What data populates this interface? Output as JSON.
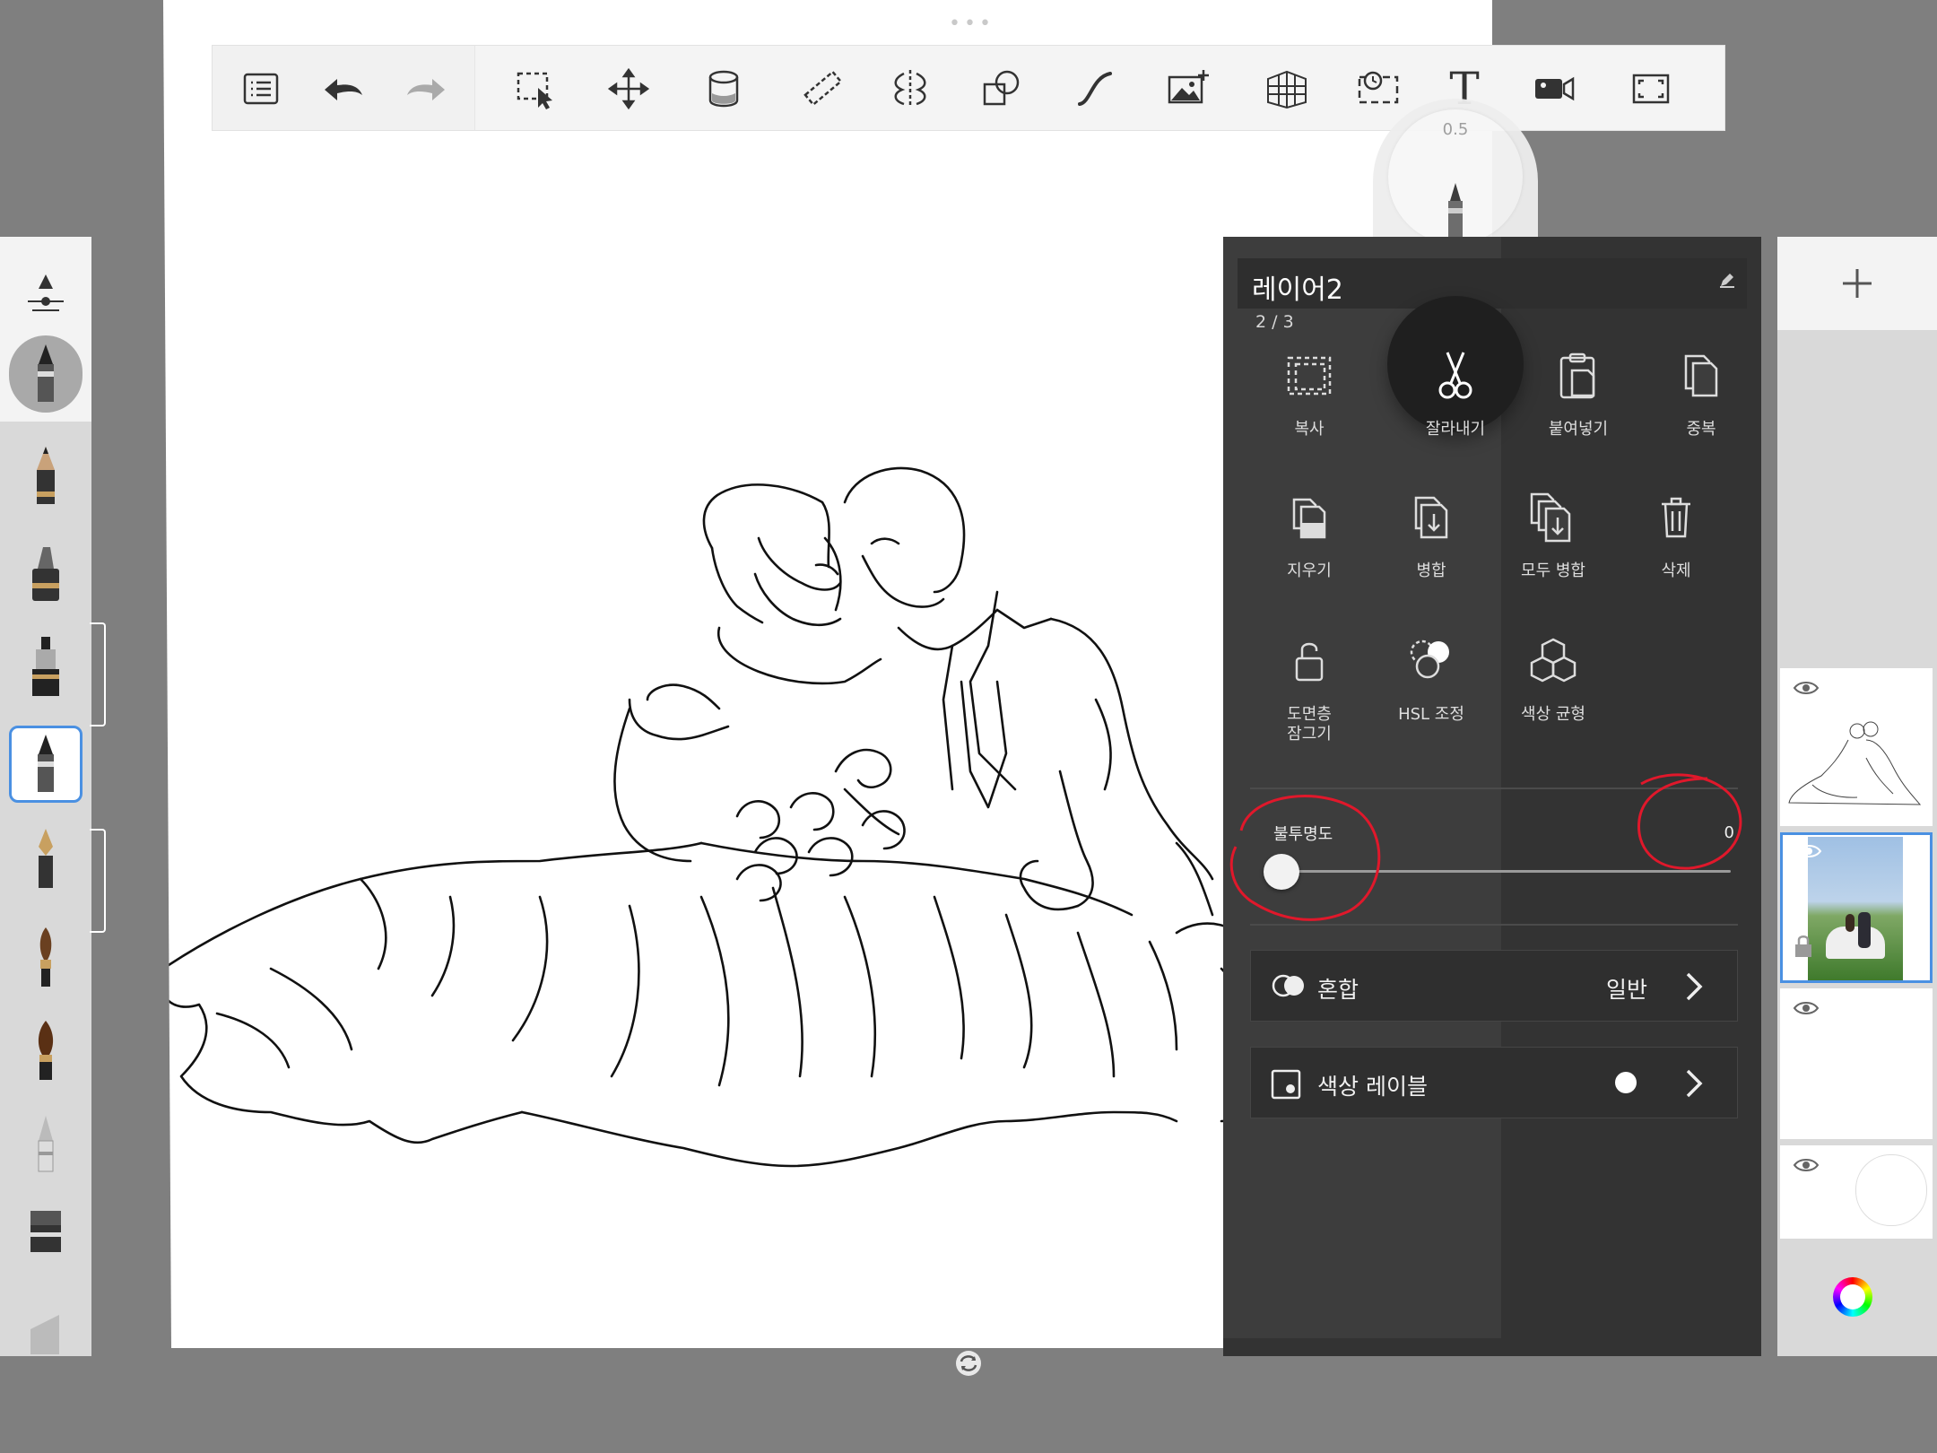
{
  "toolbar": {
    "icons": [
      "list-icon",
      "undo-icon",
      "redo-icon",
      "selection-icon",
      "transform-icon",
      "fill-icon",
      "ruler-icon",
      "symmetry-icon",
      "shape-icon",
      "curve-icon",
      "add-image-icon",
      "perspective-icon",
      "time-lapse-icon",
      "text-icon",
      "video-icon",
      "fullscreen-icon"
    ],
    "text_glyph": "T"
  },
  "brush_puck": {
    "size": "0.5"
  },
  "brushes": [
    "brush-settings-icon",
    "current-brush-icon",
    "pencil-icon",
    "marker-icon",
    "technical-pen-icon",
    "ballpoint-pen-icon",
    "fountain-pen-icon",
    "paintbrush-icon",
    "round-brush-icon",
    "airbrush-icon",
    "flat-marker-icon",
    "chisel-icon"
  ],
  "layer_panel": {
    "layer_name": "레이어2",
    "layer_count": "2 / 3",
    "actions": [
      {
        "label": "복사",
        "icon": "copy-icon"
      },
      {
        "label": "잘라내기",
        "icon": "scissors-icon"
      },
      {
        "label": "붙여넣기",
        "icon": "paste-icon"
      },
      {
        "label": "중복",
        "icon": "duplicate-icon"
      },
      {
        "label": "지우기",
        "icon": "clear-icon"
      },
      {
        "label": "병합",
        "icon": "merge-icon"
      },
      {
        "label": "모두 병합",
        "icon": "merge-all-icon"
      },
      {
        "label": "삭제",
        "icon": "trash-icon"
      },
      {
        "label": "도면층\n잠그기",
        "icon": "lock-icon"
      },
      {
        "label": "HSL 조정",
        "icon": "hsl-icon"
      },
      {
        "label": "색상 균형",
        "icon": "color-balance-icon"
      }
    ],
    "opacity": {
      "label": "불투명도",
      "value": "0"
    },
    "blend": {
      "label": "혼합",
      "value": "일반"
    },
    "color_label": {
      "label": "색상 레이블"
    }
  },
  "layers": [
    {
      "name": "line-art-layer",
      "visible": true,
      "selected": false
    },
    {
      "name": "photo-layer",
      "visible": true,
      "selected": true
    },
    {
      "name": "empty-layer",
      "visible": true,
      "selected": false
    },
    {
      "name": "background-layer",
      "visible": true,
      "selected": false
    }
  ],
  "colors": {
    "accent": "#4a90e2",
    "panel": "#333333",
    "annotation": "#e0182b"
  }
}
